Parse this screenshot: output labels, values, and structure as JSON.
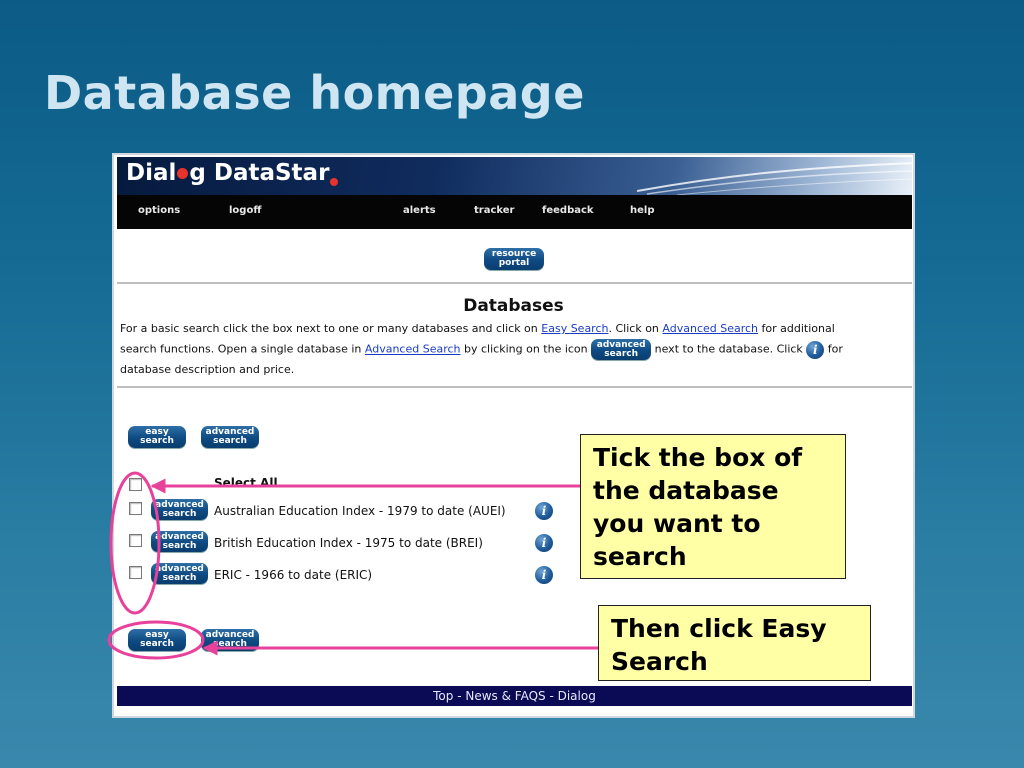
{
  "slide": {
    "title": "Database homepage"
  },
  "app": {
    "logo_part1": "Dial",
    "logo_part2": "g DataStar",
    "nav": [
      "options",
      "logoff",
      "alerts",
      "tracker",
      "feedback",
      "help"
    ],
    "resource_portal": "resource\nportal",
    "heading": "Databases",
    "instructions": {
      "l1_pre": "For a basic search click the box next to one or many databases and click on ",
      "l1_link1": "Easy Search",
      "l1_mid": ". Click on ",
      "l1_link2": "Advanced Search",
      "l1_post": " for additional",
      "l2_pre": "search functions. Open a single database in ",
      "l2_link": "Advanced Search",
      "l2_mid": " by clicking on the icon ",
      "l2_post": " next to the database. Click ",
      "l2_end": " for",
      "l3": "database description and price."
    },
    "buttons": {
      "easy": "easy\nsearch",
      "advanced": "advanced\nsearch"
    },
    "info_glyph": "i",
    "select_all": "Select All",
    "databases": [
      {
        "label": "Australian Education Index - 1979 to date (AUEI)"
      },
      {
        "label": "British Education Index - 1975 to date (BREI)"
      },
      {
        "label": "ERIC - 1966 to date (ERIC)"
      }
    ],
    "footer": {
      "top": "Top",
      "sep": " - ",
      "news": "News & FAQS",
      "dialog": "Dialog"
    }
  },
  "callouts": {
    "tick": "Tick the box of the database you want to search",
    "then": "Then click Easy Search"
  },
  "colors": {
    "annotation": "#e8419b",
    "callout_bg": "#ffffa6",
    "footer_bg": "#0a0a55"
  }
}
